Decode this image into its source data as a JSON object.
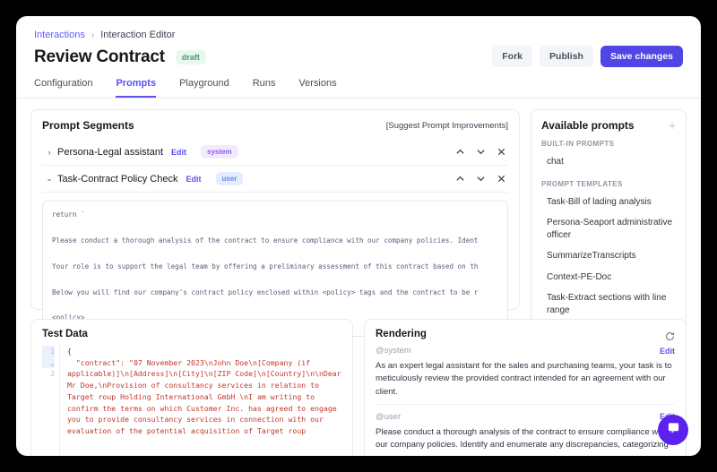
{
  "breadcrumb": {
    "root": "Interactions",
    "separator": "›",
    "current": "Interaction Editor"
  },
  "header": {
    "title": "Review Contract",
    "status_badge": "draft",
    "fork_label": "Fork",
    "publish_label": "Publish",
    "save_label": "Save changes"
  },
  "tabs": [
    {
      "label": "Configuration",
      "active": false
    },
    {
      "label": "Prompts",
      "active": true
    },
    {
      "label": "Playground",
      "active": false
    },
    {
      "label": "Runs",
      "active": false
    },
    {
      "label": "Versions",
      "active": false
    }
  ],
  "segments": {
    "title": "Prompt Segments",
    "suggest_label": "[Suggest Prompt Improvements]",
    "rows": [
      {
        "caret": "›",
        "name": "Persona-Legal assistant",
        "edit_label": "Edit",
        "role": "system"
      },
      {
        "caret": "⌄",
        "name": "Task-Contract Policy Check",
        "edit_label": "Edit",
        "role": "user"
      }
    ],
    "editor_text": "return `\n\nPlease conduct a thorough analysis of the contract to ensure compliance with our company policies. Ident\n\nYour role is to support the legal team by offering a preliminary assessment of this contract based on th\n\nBelow you will find our company's contract policy enclosed within <policy> tags and the contract to be r\n\n<policy>\n${policy}\n</policy>"
  },
  "available_prompts": {
    "title": "Available prompts",
    "add_icon": "plus-icon",
    "groups": [
      {
        "label": "BUILT-IN PROMPTS",
        "items": [
          "chat"
        ]
      },
      {
        "label": "PROMPT TEMPLATES",
        "items": [
          "Task-Bill of lading analysis",
          "Persona-Seaport administrative officer",
          "SummarizeTranscripts",
          "Context-PE-Doc",
          "Task-Extract sections with line range"
        ]
      }
    ]
  },
  "test_data": {
    "title": "Test Data",
    "line_numbers": [
      "1",
      "2"
    ],
    "open_brace": "{",
    "json_text": "  \"contract\": \"07 November 2023\\nJohn Doe\\n[Company (if applicable)]\\n[Address]\\n[City]\\n[ZIP Code]\\n[Country]\\n\\nDear Mr Doe,\\nProvision of consultancy services in relation to Target roup Holding International GmbH \\nI am writing to confirm the terms on which Customer Inc. has agreed to engage you to provide consultancy services in connection with our evaluation of the potential acquisition of Target roup"
  },
  "rendering": {
    "title": "Rendering",
    "refresh_icon": "refresh-icon",
    "messages": [
      {
        "role": "@system",
        "edit_label": "Edit",
        "text": "As an expert legal assistant for the sales and purchasing teams, your task is to meticulously review the provided contract intended for an agreement with our client."
      },
      {
        "role": "@user",
        "edit_label": "Edit",
        "text": "Please conduct a thorough analysis of the contract to ensure compliance with our company policies. Identify and enumerate any discrepancies, categorizing"
      }
    ]
  },
  "chat_widget": {
    "icon": "chat-bubble-icon"
  },
  "colors": {
    "accent": "#5b52f0",
    "primary_button": "#4f46e5",
    "draft_badge_bg": "#e9f7ef",
    "draft_badge_text": "#3f9e6b",
    "system_badge_bg": "#f3ebfd",
    "system_badge_text": "#8b5cf6",
    "user_badge_bg": "#e4edfd",
    "user_badge_text": "#5b8def",
    "json_string": "#c0392b",
    "chat_widget": "#5b21ed"
  }
}
